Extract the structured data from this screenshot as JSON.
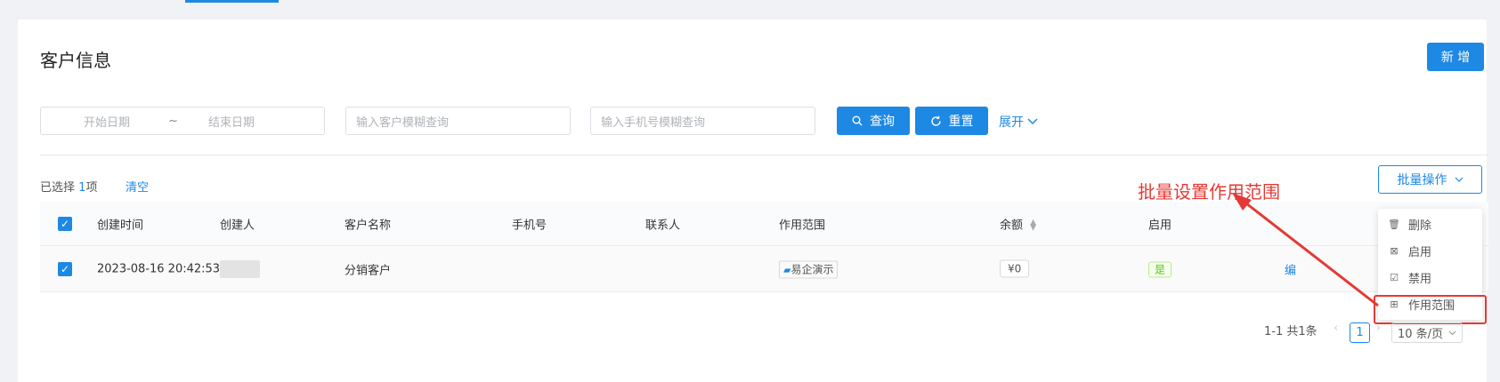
{
  "page": {
    "title": "客户信息",
    "new_button": "新 增"
  },
  "filters": {
    "date_start_placeholder": "开始日期",
    "date_separator": "~",
    "date_end_placeholder": "结束日期",
    "customer_placeholder": "输入客户模糊查询",
    "phone_placeholder": "输入手机号模糊查询",
    "query_button": "查询",
    "reset_button": "重置",
    "expand_link": "展开"
  },
  "selection": {
    "prefix": "已选择",
    "count": "1",
    "suffix": "项",
    "clear": "清空"
  },
  "annotation": {
    "text": "批量设置作用范围",
    "color": "#e53935"
  },
  "batch": {
    "button": "批量操作",
    "menu": [
      {
        "label": "删除",
        "icon": "trash-icon"
      },
      {
        "label": "启用",
        "icon": "enable-icon"
      },
      {
        "label": "禁用",
        "icon": "disable-icon"
      },
      {
        "label": "作用范围",
        "icon": "scope-grid-icon"
      }
    ]
  },
  "table": {
    "columns": [
      "创建时间",
      "创建人",
      "客户名称",
      "手机号",
      "联系人",
      "作用范围",
      "余额",
      "启用"
    ],
    "rows": [
      {
        "created_at": "2023-08-16 20:42:53",
        "creator": "",
        "customer_name": "分销客户",
        "phone": "",
        "contact": "",
        "scope": "易企演示",
        "balance": "¥0",
        "enabled": "是",
        "action": "编"
      }
    ]
  },
  "pagination": {
    "total": "1-1 共1条",
    "current_page": "1",
    "page_size": "10 条/页"
  },
  "colors": {
    "primary": "#1e88e5",
    "highlight": "#e53935",
    "success": "#52c41a"
  }
}
